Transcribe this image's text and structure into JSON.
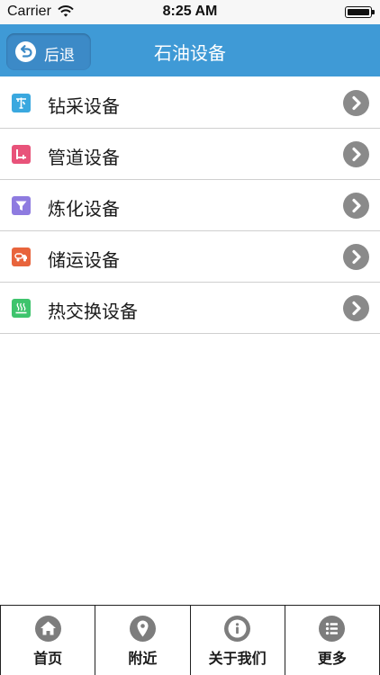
{
  "status_bar": {
    "carrier": "Carrier",
    "time": "8:25 AM",
    "wifi_icon": "wifi-icon",
    "battery_icon": "battery-full-icon"
  },
  "nav_bar": {
    "back_label": "后退",
    "back_icon": "undo-arrow-icon",
    "title": "石油设备",
    "color": "#3f9ad6"
  },
  "list": {
    "items": [
      {
        "label": "钻采设备",
        "icon": "drilling-rig-icon",
        "icon_color": "#3aa8df"
      },
      {
        "label": "管道设备",
        "icon": "pipeline-icon",
        "icon_color": "#e8537a"
      },
      {
        "label": "炼化设备",
        "icon": "funnel-icon",
        "icon_color": "#8e7be0"
      },
      {
        "label": "储运设备",
        "icon": "tanker-truck-icon",
        "icon_color": "#e8643c"
      },
      {
        "label": "热交换设备",
        "icon": "heat-exchange-icon",
        "icon_color": "#3ec46d"
      }
    ],
    "chevron_icon": "chevron-right-circle-icon"
  },
  "tab_bar": {
    "tabs": [
      {
        "label": "首页",
        "icon": "home-icon"
      },
      {
        "label": "附近",
        "icon": "location-pin-icon"
      },
      {
        "label": "关于我们",
        "icon": "info-icon"
      },
      {
        "label": "更多",
        "icon": "list-icon"
      }
    ]
  }
}
